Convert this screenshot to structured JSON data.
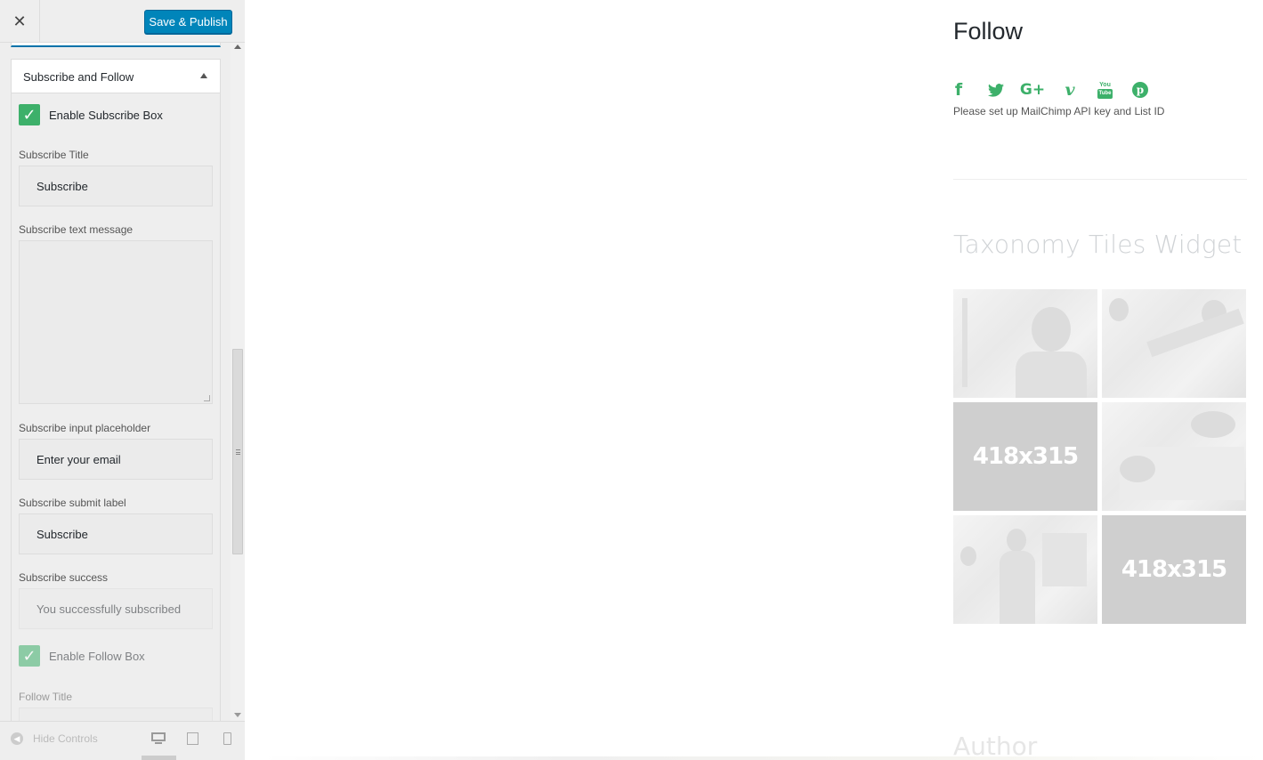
{
  "toolbar": {
    "close_label": "✕",
    "publish_label": "Save & Publish"
  },
  "section": {
    "title": "Subscribe and Follow"
  },
  "controls": {
    "enable_subscribe_label": "Enable Subscribe Box",
    "enable_subscribe_checked": true,
    "subscribe_title_label": "Subscribe Title",
    "subscribe_title_value": "Subscribe",
    "subscribe_text_label": "Subscribe text message",
    "subscribe_text_value": "",
    "placeholder_label": "Subscribe input placeholder",
    "placeholder_value": "Enter your email",
    "submit_label_label": "Subscribe submit label",
    "submit_label_value": "Subscribe",
    "success_label": "Subscribe success",
    "success_value": "You successfully subscribed",
    "enable_follow_label": "Enable Follow Box",
    "enable_follow_checked": true,
    "follow_title_label": "Follow Title"
  },
  "footer": {
    "hide_controls_label": "Hide Controls",
    "devices": [
      "desktop-icon",
      "tablet-icon",
      "mobile-icon"
    ]
  },
  "preview": {
    "follow_title": "Follow",
    "social_icons": [
      "facebook-icon",
      "twitter-icon",
      "google-plus-icon",
      "vimeo-icon",
      "youtube-icon",
      "pinterest-icon"
    ],
    "social_glyphs": {
      "facebook": "f",
      "twitter": "🐦",
      "google_plus": "G+",
      "vimeo": "v",
      "youtube_top": "You",
      "youtube_bottom": "Tube",
      "pinterest": "p"
    },
    "mailchimp_note": "Please set up MailChimp API key and List ID",
    "taxonomy_title": "Taxonomy Tiles Widget",
    "placeholder_tile_text": "418x315",
    "author_title": "Author"
  },
  "colors": {
    "accent_green": "#3db06a",
    "publish_blue": "#0085ba",
    "sidebar_bg": "#eeeeee"
  }
}
